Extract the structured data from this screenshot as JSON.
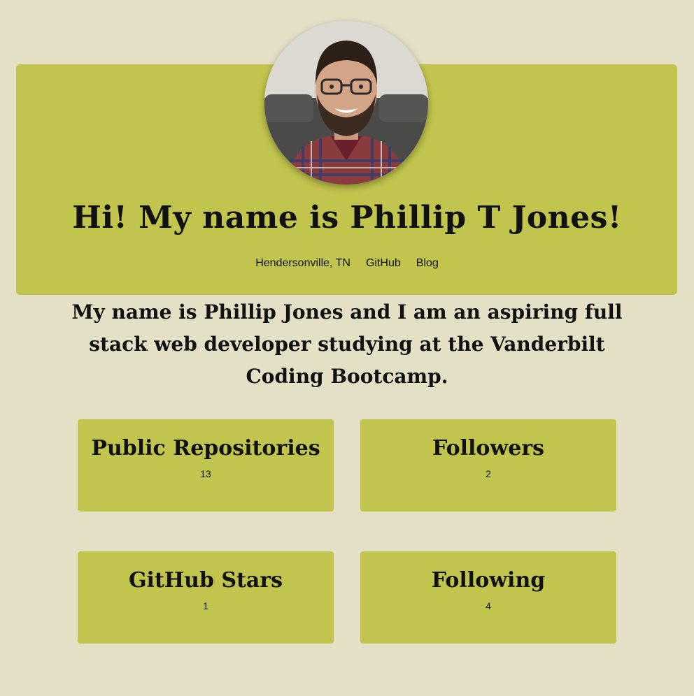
{
  "header": {
    "headline": "Hi! My name is Phillip T Jones!",
    "links": {
      "location": "Hendersonville, TN",
      "github": "GitHub",
      "blog": "Blog"
    },
    "avatar_icon": "profile-photo"
  },
  "bio": "My name is Phillip Jones and I am an aspiring full stack web developer studying at the Vanderbilt Coding Bootcamp.",
  "stats": {
    "public_repos": {
      "label": "Public Repositories",
      "value": "13"
    },
    "followers": {
      "label": "Followers",
      "value": "2"
    },
    "stars": {
      "label": "GitHub Stars",
      "value": "1"
    },
    "following": {
      "label": "Following",
      "value": "4"
    }
  },
  "colors": {
    "page_background": "#e4e0c6",
    "card_background": "#c2c54d",
    "text": "#111111"
  }
}
